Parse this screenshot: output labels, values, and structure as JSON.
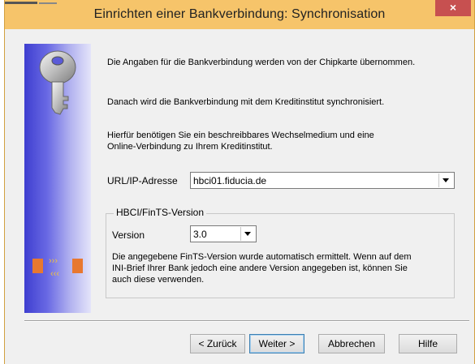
{
  "window": {
    "title": "Einrichten einer Bankverbindung: Synchronisation",
    "close_glyph": "×"
  },
  "content": {
    "para1": "Die Angaben für die Bankverbindung werden von der Chipkarte übernommen.",
    "para2": "Danach wird die Bankverbindung mit dem Kreditinstitut synchronisiert.",
    "para3_line1": "Hierfür benötigen Sie ein beschreibbares Wechselmedium und eine",
    "para3_line2": "Online-Verbindung zu Ihrem Kreditinstitut."
  },
  "url_field": {
    "label": "URL/IP-Adresse",
    "value": "hbci01.fiducia.de"
  },
  "hbci_group": {
    "title": "HBCI/FinTS-Version",
    "version_label": "Version",
    "version_value": "3.0",
    "note_line1": "Die angegebene FinTS-Version wurde automatisch ermittelt. Wenn auf dem",
    "note_line2": "INI-Brief Ihrer Bank jedoch eine andere Version angegeben ist, können Sie",
    "note_line3": "auch diese verwenden."
  },
  "buttons": {
    "back": "< Zurück",
    "next": "Weiter >",
    "cancel": "Abbrechen",
    "help": "Hilfe"
  },
  "icons": [
    "key-icon",
    "transfer-arrows-icon",
    "chevron-down-icon",
    "close-icon"
  ],
  "colors": {
    "titlebar": "#f6c46a",
    "close": "#c75050",
    "sidebar_dark": "#3e3ed0"
  }
}
